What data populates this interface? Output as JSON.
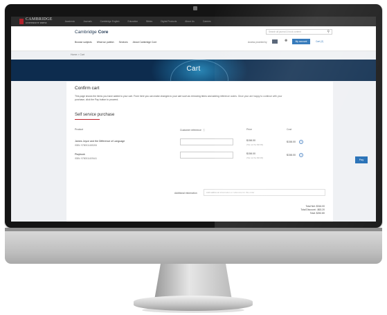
{
  "topbar": {
    "logo": {
      "name": "CAMBRIDGE",
      "sub": "UNIVERSITY PRESS"
    },
    "nav": [
      "Academic",
      "Journals",
      "Cambridge English",
      "Education",
      "Bibles",
      "Digital Products",
      "About Us",
      "Careers"
    ]
  },
  "header": {
    "brand_prefix": "Cambridge",
    "brand_name": "Core",
    "search_placeholder": "Search all journal & book content",
    "subnav": [
      "Browse subjects",
      "What we publish",
      "Services",
      "About Cambridge Core"
    ],
    "access_text": "Access provided by",
    "account_button": "My account",
    "cart_link": "Cart (2)"
  },
  "breadcrumb": "Home > Cart",
  "banner": {
    "title": "Cart"
  },
  "cart": {
    "title": "Confirm cart",
    "description": "This page shows the items you have added to your cart. From here you can make changes to your cart such as removing items and adding reference codes. Once your are happy to continue with your purchase, click the Pay button to proceed.",
    "section_title": "Self service purchase",
    "columns": {
      "product": "Product",
      "reference": "Customer reference",
      "price": "Price",
      "cost": "Cost"
    },
    "items": [
      {
        "title": "James Joyce and the Difference of Language",
        "isbn": "ISBN: 9780511485206",
        "price": "$158.00",
        "price_sub": "(Tax at the $0.00)",
        "cost": "$158.00"
      },
      {
        "title": "Playbook",
        "isbn": "ISBN: 9780511409441",
        "price": "$158.00",
        "price_sub": "(Tax at the $0.00)",
        "cost": "$158.00"
      }
    ],
    "additional_label": "Additional information",
    "additional_placeholder": "Add additional information or reference for this order",
    "totals": {
      "net": "Total Net: $316.00",
      "discount": "Total Discount: -$63.20",
      "total": "Total: $252.80"
    },
    "pay_label": "Pay"
  },
  "colors": {
    "topbar": "#2b2b2b",
    "brand_blue": "#1d6ab3",
    "accent_red": "#c0232c",
    "bezel": "#141414"
  }
}
